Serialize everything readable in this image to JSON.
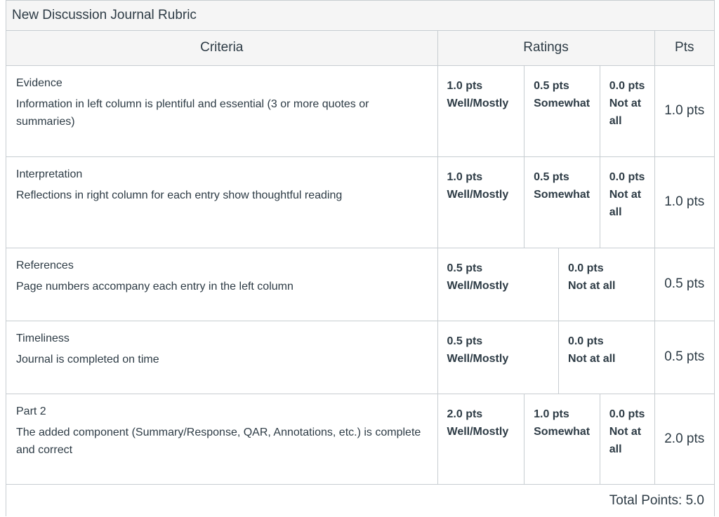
{
  "rubric": {
    "title": "New Discussion Journal Rubric",
    "headers": {
      "criteria": "Criteria",
      "ratings": "Ratings",
      "pts": "Pts"
    },
    "rows": [
      {
        "title": "Evidence",
        "description": "Information in left column is plentiful and essential (3 or more quotes or summaries)",
        "ratings": [
          {
            "pts": "1.0 pts",
            "label": "Well/Mostly"
          },
          {
            "pts": "0.5 pts",
            "label": "Somewhat"
          },
          {
            "pts": "0.0 pts",
            "label": "Not at all"
          }
        ],
        "points": "1.0 pts"
      },
      {
        "title": "Interpretation",
        "description": "Reflections in right column for each entry show thoughtful reading",
        "ratings": [
          {
            "pts": "1.0 pts",
            "label": "Well/Mostly"
          },
          {
            "pts": "0.5 pts",
            "label": "Somewhat"
          },
          {
            "pts": "0.0 pts",
            "label": "Not at all"
          }
        ],
        "points": "1.0 pts"
      },
      {
        "title": "References",
        "description": "Page numbers accompany each entry in the left column",
        "ratings": [
          {
            "pts": "0.5 pts",
            "label": "Well/Mostly"
          },
          {
            "pts": "0.0 pts",
            "label": "Not at all"
          }
        ],
        "points": "0.5 pts"
      },
      {
        "title": "Timeliness",
        "description": "Journal is completed on time",
        "ratings": [
          {
            "pts": "0.5 pts",
            "label": "Well/Mostly"
          },
          {
            "pts": "0.0 pts",
            "label": "Not at all"
          }
        ],
        "points": "0.5 pts"
      },
      {
        "title": "Part 2",
        "description": "The added component (Summary/Response, QAR, Annotations, etc.) is complete and correct",
        "ratings": [
          {
            "pts": "2.0 pts",
            "label": "Well/Mostly"
          },
          {
            "pts": "1.0 pts",
            "label": "Somewhat"
          },
          {
            "pts": "0.0 pts",
            "label": "Not at all"
          }
        ],
        "points": "2.0 pts"
      }
    ],
    "total": "Total Points: 5.0"
  }
}
